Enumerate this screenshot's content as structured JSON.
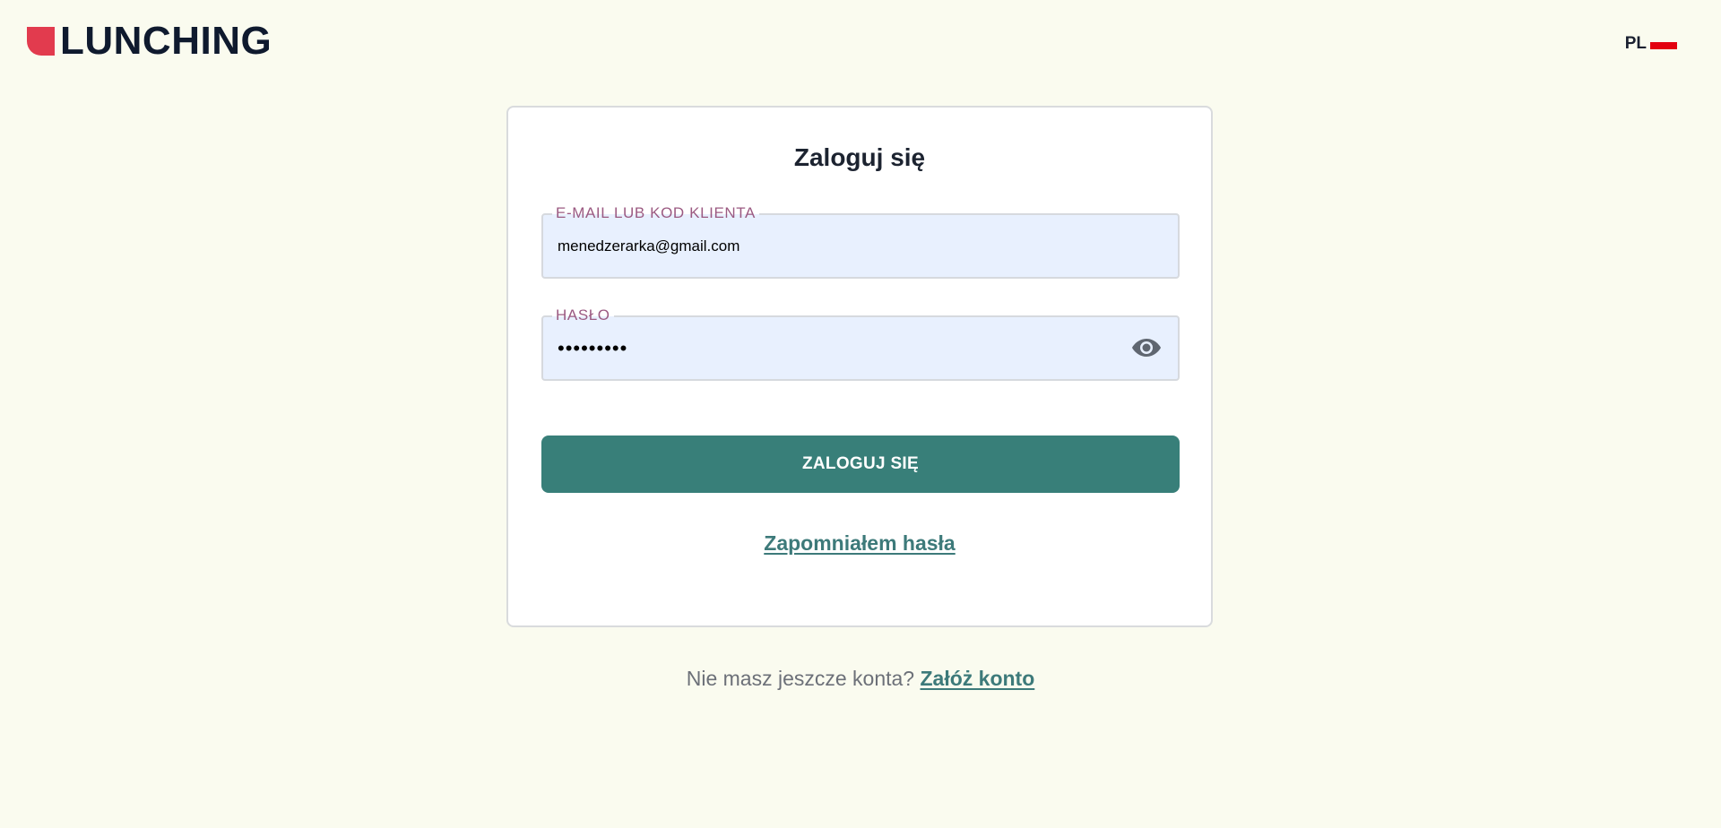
{
  "header": {
    "logo_text": "LUNCHING",
    "brand_color": "#e23b4e",
    "language": {
      "code": "PL",
      "flag_color": "#e3000f"
    }
  },
  "login_card": {
    "title": "Zaloguj się",
    "email_field": {
      "label": "E-MAIL LUB KOD KLIENTA",
      "value": "menedzerarka@gmail.com"
    },
    "password_field": {
      "label": "HASŁO",
      "value": "•••••••••",
      "toggle_icon": "eye-icon"
    },
    "submit_label": "ZALOGUJ SIĘ",
    "submit_color": "#387f79",
    "forgot_password": "Zapomniałem hasła"
  },
  "footer": {
    "no_account_text": "Nie masz jeszcze konta?",
    "register_link": "Załóż konto"
  }
}
